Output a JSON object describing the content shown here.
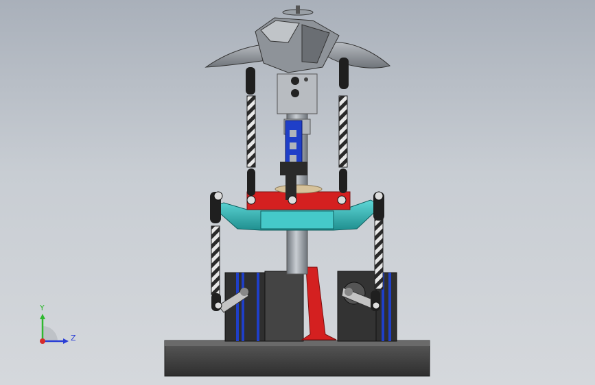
{
  "viewport": {
    "background_top": "#a9b0ba",
    "background_bottom": "#d5d8dc"
  },
  "triad": {
    "y_label": "Y",
    "z_label": "Z",
    "y_color": "#2fb82f",
    "z_color": "#2b3fd6",
    "x_color": "#d62b2b"
  },
  "model": {
    "colors": {
      "base": "#3d3d3d",
      "swashplate_lower": "#2ab3b3",
      "swashplate_upper": "#d42020",
      "link_blue": "#1f3fc8",
      "shaft": "#9aa0a8",
      "servo_body": "#3a3a3a",
      "blade": "#8e9399"
    }
  }
}
